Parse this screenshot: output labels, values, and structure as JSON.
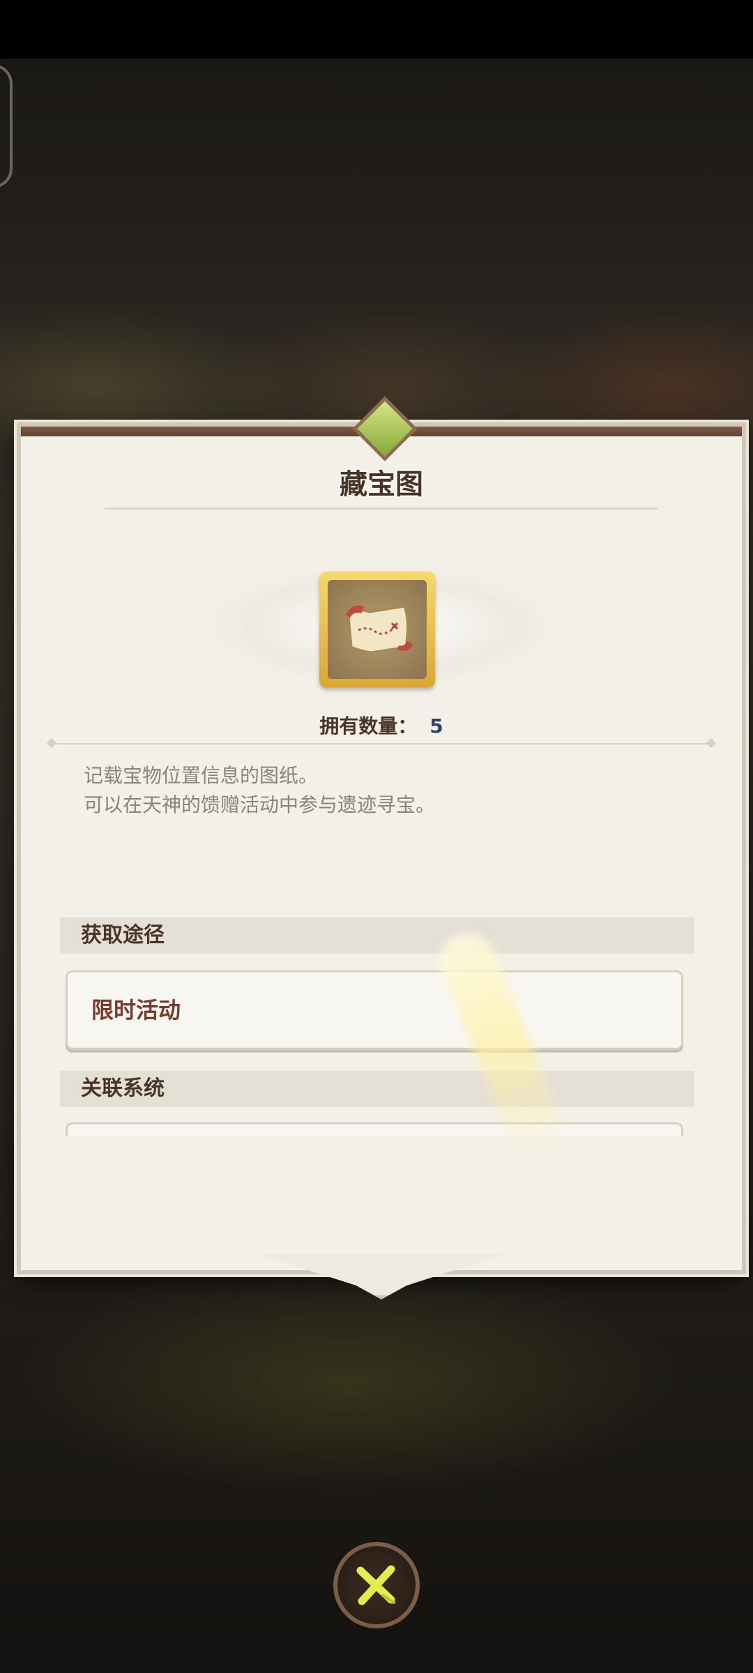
{
  "dialog": {
    "title": "藏宝图",
    "item_icon": "treasure-map-icon",
    "count_label": "拥有数量：",
    "count_value": "5",
    "description_lines": [
      "记载宝物位置信息的图纸。",
      "可以在天神的馈赠活动中参与遗迹寻宝。"
    ],
    "sections": {
      "acquire_title": "获取途径",
      "acquire_items": [
        "限时活动"
      ],
      "related_title": "关联系统"
    }
  },
  "close_button": {
    "icon": "close-x-icon"
  },
  "colors": {
    "panel_bg": "#f3f0e7",
    "title_text": "#4a3426",
    "accent_gold": "#d9a734",
    "count_value": "#2e3e6b",
    "source_text": "#7a3b2a"
  }
}
